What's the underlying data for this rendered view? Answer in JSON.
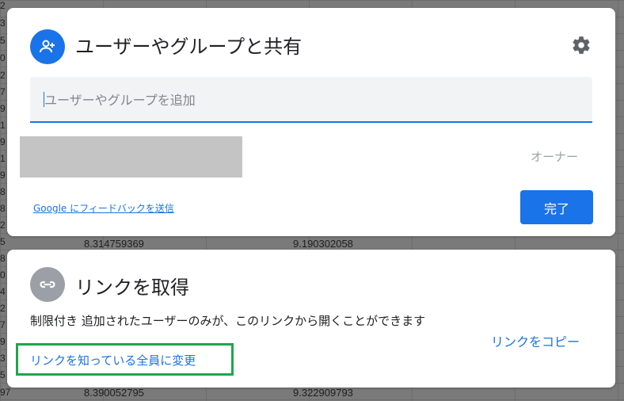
{
  "background": {
    "row_numbers": [
      "2",
      "3",
      "5",
      "0",
      "2",
      "7",
      "9",
      "1",
      "9",
      "1",
      "9",
      "8",
      "8",
      "2",
      "5",
      "8",
      "0",
      "4",
      "2",
      "7",
      "9",
      "3",
      "5",
      "9",
      "4",
      "0",
      "5",
      "1",
      "2",
      "7",
      "5",
      "97"
    ],
    "cells": [
      "8.314759369",
      "9.190302058",
      "8.390052795",
      "9.322909793"
    ]
  },
  "share_dialog": {
    "title": "ユーザーやグループと共有",
    "input_placeholder": "ユーザーやグループを追加",
    "input_value": "",
    "owner_label": "オーナー",
    "feedback_link": "Google にフィードバックを送信",
    "done_label": "完了"
  },
  "link_dialog": {
    "title": "リンクを取得",
    "description": "制限付き 追加されたユーザーのみが、このリンクから開くことができます",
    "change_link": "リンクを知っている全員に変更",
    "copy_link": "リンクをコピー"
  },
  "colors": {
    "accent": "#1a73e8",
    "highlight": "#1fa64b",
    "icon_gray": "#9aa0a6"
  }
}
